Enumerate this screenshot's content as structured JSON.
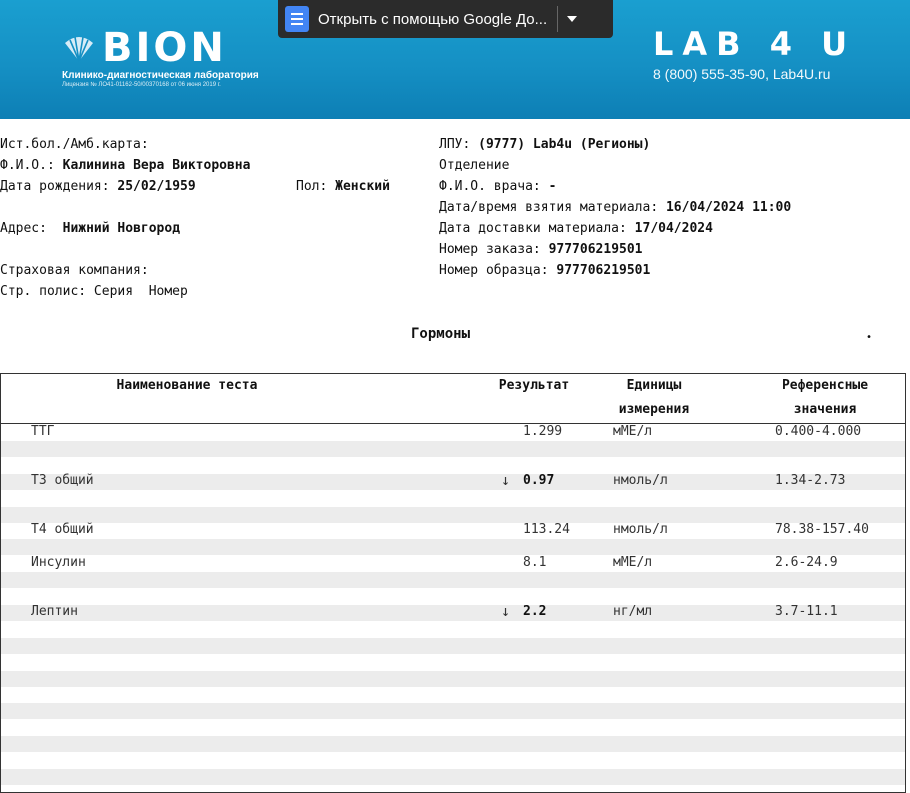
{
  "header": {
    "left_logo_text": "BION",
    "left_logo_sub": "Клинико-диагностическая лаборатория",
    "left_logo_license": "Лицензия № ЛО41-01162-50/00370168 от 06 июня 2019 г.",
    "right_logo_text": "LAB 4 U",
    "right_logo_contact": "8 (800) 555-35-90, Lab4U.ru"
  },
  "google_docs_bar": {
    "label": "Открыть с помощью Google До...",
    "icon": "google-docs-icon"
  },
  "patient": {
    "card_label": "Ист.бол./Амб.карта:",
    "name_label": "Ф.И.О.:",
    "name_value": "Калинина Вера Викторовна",
    "dob_label": "Дата рождения:",
    "dob_value": "25/02/1959",
    "sex_label": "Пол:",
    "sex_value": "Женский",
    "address_label": "Адрес:",
    "address_value": "Нижний Новгород",
    "insurance_label": "Страховая компания:",
    "policy_label": "Стр. полис: Серия  Номер"
  },
  "order": {
    "lpu_label": "ЛПУ:",
    "lpu_value": "(9777) Lab4u (Регионы)",
    "department_label": "Отделение",
    "doctor_label": "Ф.И.О. врача:",
    "doctor_value": "-",
    "taken_label": "Дата/время взятия материала:",
    "taken_value": "16/04/2024 11:00",
    "delivered_label": "Дата доставки материала:",
    "delivered_value": "17/04/2024",
    "order_no_label": "Номер заказа:",
    "order_no_value": "977706219501",
    "sample_no_label": "Номер образца:",
    "sample_no_value": "977706219501"
  },
  "section_title": "Гормоны",
  "table": {
    "headers": {
      "name": "Наименование теста",
      "result": "Результат",
      "units_1": "Единицы",
      "units_2": "измерения",
      "ref_1": "Референсные",
      "ref_2": "значения"
    },
    "rows": [
      {
        "name": "ТТГ",
        "flag": "",
        "result": "1.299",
        "units": "мМЕ/л",
        "ref": "0.400-4.000"
      },
      {
        "name": "Т3 общий",
        "flag": "↓",
        "result": "0.97",
        "units": "нмоль/л",
        "ref": "1.34-2.73"
      },
      {
        "name": "Т4 общий",
        "flag": "",
        "result": "113.24",
        "units": "нмоль/л",
        "ref": "78.38-157.40"
      },
      {
        "name": "Инсулин",
        "flag": "",
        "result": "8.1",
        "units": "мМЕ/л",
        "ref": "2.6-24.9"
      },
      {
        "name": "Лептин",
        "flag": "↓",
        "result": "2.2",
        "units": "нг/мл",
        "ref": "3.7-11.1"
      }
    ]
  }
}
